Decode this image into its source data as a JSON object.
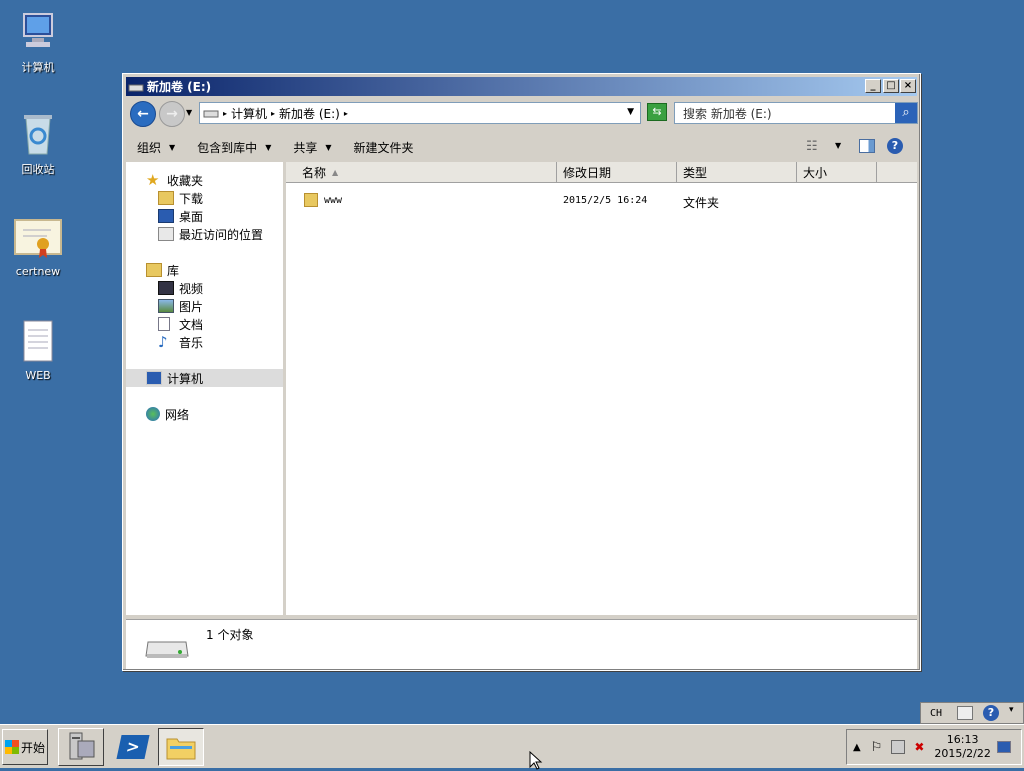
{
  "desktop": {
    "icons": [
      {
        "label": "计算机"
      },
      {
        "label": "回收站"
      },
      {
        "label": "certnew"
      },
      {
        "label": "WEB"
      }
    ]
  },
  "window": {
    "title": "新加卷 (E:)",
    "breadcrumb": [
      "计算机",
      "新加卷 (E:)"
    ],
    "search_placeholder": "搜索 新加卷 (E:)",
    "toolbar": [
      "组织",
      "包含到库中",
      "共享",
      "新建文件夹"
    ],
    "nav": {
      "favorites": "收藏夹",
      "favorite_items": [
        "下载",
        "桌面",
        "最近访问的位置"
      ],
      "libraries": "库",
      "library_items": [
        "视频",
        "图片",
        "文档",
        "音乐"
      ],
      "computer": "计算机",
      "network": "网络"
    },
    "columns": [
      "名称",
      "修改日期",
      "类型",
      "大小"
    ],
    "files": [
      {
        "name": "www",
        "modified": "2015/2/5 16:24",
        "type": "文件夹",
        "size": ""
      }
    ],
    "status": "1 个对象"
  },
  "taskbar": {
    "start_label": "开始",
    "time": "16:13",
    "date": "2015/2/22",
    "lang": "CH"
  },
  "colors": {
    "desktop": "#3a6ea5",
    "titlebar": "#0a246a",
    "chrome": "#d4d0c8"
  }
}
